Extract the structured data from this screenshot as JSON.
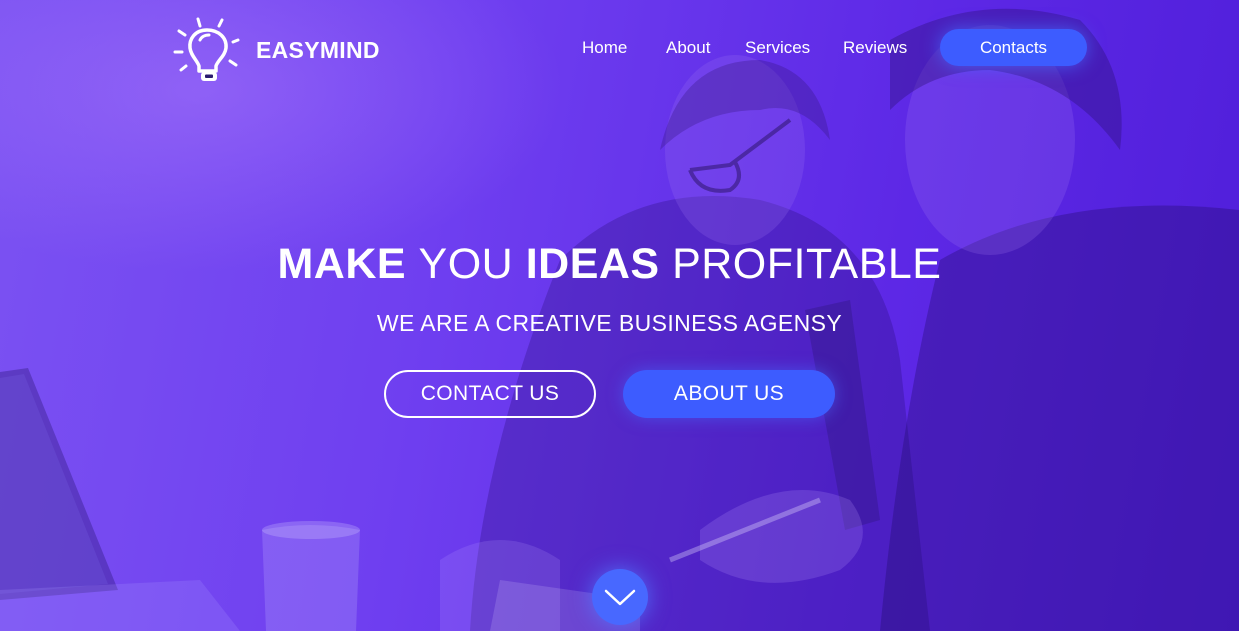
{
  "brand": {
    "name": "EASYMIND",
    "icon": "lightbulb-icon"
  },
  "nav": {
    "items": [
      {
        "label": "Home"
      },
      {
        "label": "About"
      },
      {
        "label": "Services"
      },
      {
        "label": "Reviews"
      }
    ],
    "cta_label": "Contacts"
  },
  "hero": {
    "headline": {
      "part1": "MAKE",
      "part2": "YOU",
      "part3": "IDEAS",
      "part4": "PROFITABLE"
    },
    "subheadline": "WE ARE A CREATIVE BUSINESS AGENSY",
    "buttons": {
      "contact_label": "CONTACT US",
      "about_label": "ABOUT US"
    },
    "scroll_icon": "chevron-down-icon"
  },
  "colors": {
    "overlay": "#6c3cf0",
    "accent": "#3d5cff",
    "text": "#ffffff"
  }
}
